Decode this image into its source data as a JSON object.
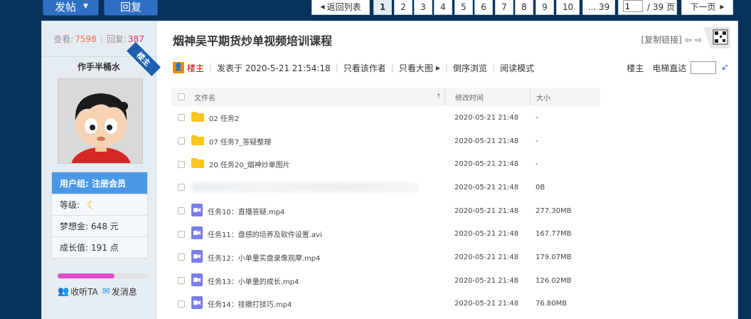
{
  "toolbar": {
    "post_label": "发帖",
    "reply_label": "回复"
  },
  "pager": {
    "back_label": "返回列表",
    "pages": [
      "1",
      "2",
      "3",
      "4",
      "5",
      "6",
      "7",
      "8",
      "9",
      "10"
    ],
    "current": "1",
    "ellipsis_label": "... 39",
    "page_input_value": "1",
    "total_label": "/ 39 页",
    "next_label": "下一页"
  },
  "sidebar": {
    "views_label": "查看:",
    "views": "7598",
    "replies_label": "回复:",
    "replies": "387",
    "author": "作手半桶水",
    "owner_tag": "楼主",
    "group_label": "用户组: 注册会员",
    "level_label": "等级:",
    "points_label": "梦想金:",
    "points_value": "648 元",
    "growth_label": "成长值:",
    "growth_value": "191 点",
    "progress": 0.62,
    "follow_label": "收听TA",
    "message_label": "发消息"
  },
  "post": {
    "title": "烟神吴平期货炒单视频培训课程",
    "copy_link": "[复制链接]",
    "owner": "楼主",
    "posted_at": "发表于 2020-5-21 21:54:18",
    "only_author": "只看该作者",
    "only_images": "只看大图",
    "reverse": "倒序浏览",
    "read_mode": "阅读模式",
    "floor": "楼主",
    "elevator": "电梯直达"
  },
  "files": {
    "headers": {
      "name": "文件名",
      "modified": "修改时间",
      "size": "大小"
    },
    "rows": [
      {
        "type": "folder",
        "name": "02 任务2",
        "modified": "2020-05-21 21:48",
        "size": "-"
      },
      {
        "type": "folder",
        "name": "07 任务7_答疑整理",
        "modified": "2020-05-21 21:48",
        "size": "-"
      },
      {
        "type": "folder",
        "name": "20 任务20_烟神炒单图片",
        "modified": "2020-05-21 21:48",
        "size": "-"
      },
      {
        "type": "blurred",
        "name": "",
        "modified": "2020-05-21 21:48",
        "size": "0B"
      },
      {
        "type": "video",
        "name": "任务10：直播答疑.mp4",
        "modified": "2020-05-21 21:48",
        "size": "277.30MB"
      },
      {
        "type": "video",
        "name": "任务11：盘感的培养及软件设置.avi",
        "modified": "2020-05-21 21:48",
        "size": "167.77MB"
      },
      {
        "type": "video",
        "name": "任务12：小单量实盘录像观摩.mp4",
        "modified": "2020-05-21 21:48",
        "size": "179.07MB"
      },
      {
        "type": "video",
        "name": "任务13：小单量的成长.mp4",
        "modified": "2020-05-21 21:48",
        "size": "126.02MB"
      },
      {
        "type": "video",
        "name": "任务14：挂撤打技巧.mp4",
        "modified": "2020-05-21 21:48",
        "size": "76.80MB"
      }
    ]
  },
  "colors": {
    "accent": "#2f6fc4",
    "group_bg": "#4b98e6",
    "owner_red": "#c00000",
    "folder": "#f8c61c",
    "video": "#7a7ee8",
    "progress": "#e04ec7"
  }
}
